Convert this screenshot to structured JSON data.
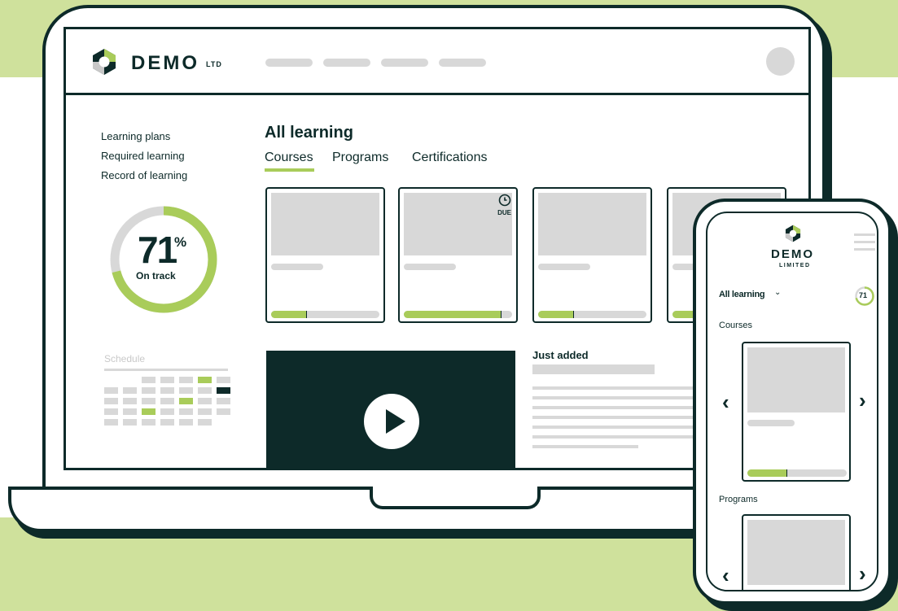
{
  "colors": {
    "accent": "#a9cc5a",
    "dark": "#0d2a29",
    "placeholder": "#d8d8d8",
    "band": "#cfe19c"
  },
  "brand": {
    "name": "DEMO",
    "suffix": "LTD",
    "mobile_suffix": "LIMITED"
  },
  "sidebar": {
    "links": [
      "Learning plans",
      "Required learning",
      "Record of learning"
    ],
    "progress": {
      "value": "71",
      "unit": "%",
      "label": "On track",
      "fraction": 0.71
    },
    "schedule_title": "Schedule"
  },
  "main": {
    "title": "All learning",
    "tabs": [
      "Courses",
      "Programs",
      "Certifications"
    ],
    "active_tab": "Courses",
    "cards": [
      {
        "progress": 0.33,
        "due": ""
      },
      {
        "progress": 0.9,
        "due": "DUE"
      },
      {
        "progress": 0.33,
        "due": ""
      },
      {
        "progress": 0.33,
        "due": ""
      }
    ],
    "just_added_title": "Just added"
  },
  "mobile": {
    "filter_label": "All learning",
    "progress_value": "71",
    "progress_unit": "%",
    "sections": [
      "Courses",
      "Programs"
    ],
    "card_progress": 0.4
  },
  "icons": {
    "logo": "hexagon-logo-icon",
    "play": "play-icon",
    "due": "clock-icon",
    "prev": "chevron-left-icon",
    "next": "chevron-right-icon",
    "menu": "hamburger-menu-icon",
    "dropdown": "chevron-down-icon"
  }
}
